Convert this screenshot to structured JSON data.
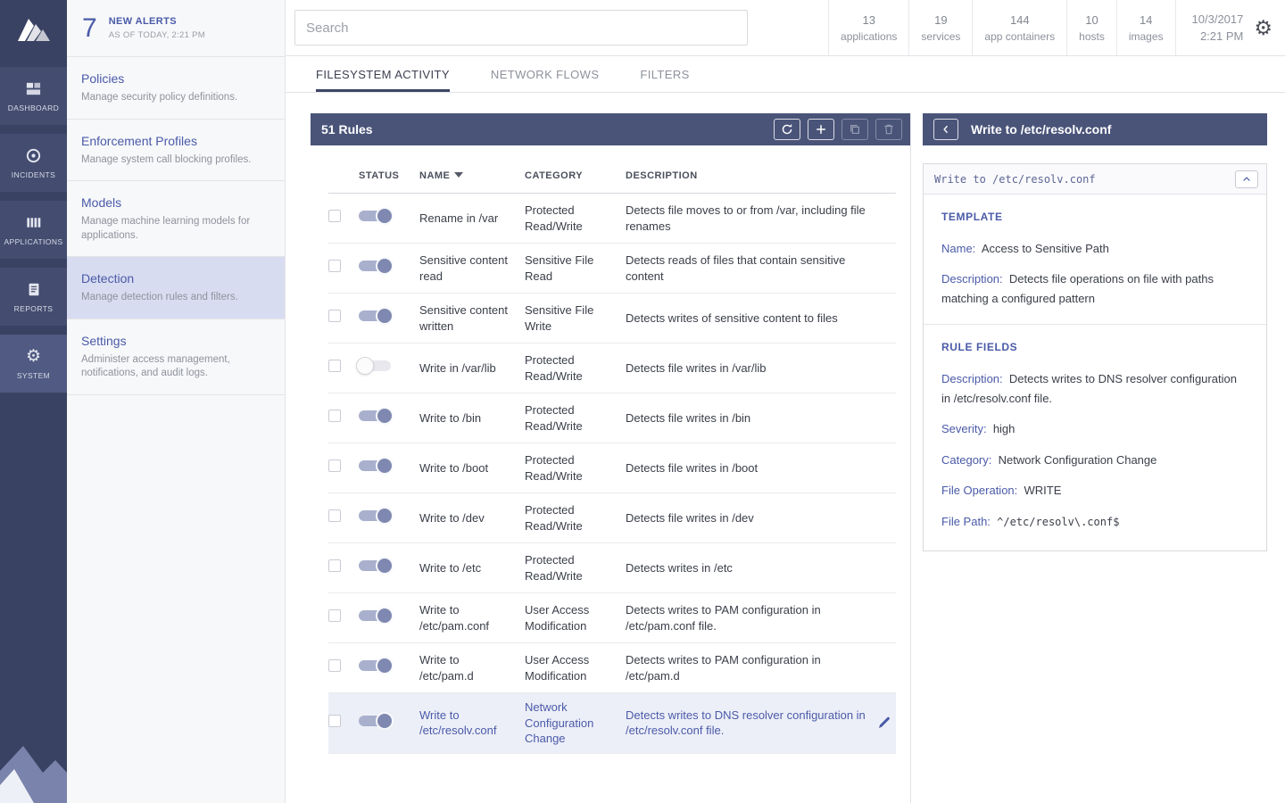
{
  "colors": {
    "accent_blue": "#4a5aa8",
    "panel_header_bg": "#4a5479",
    "sidebar_bg": "#3a4263",
    "selected_row_bg": "#edeff8"
  },
  "alerts": {
    "count": "7",
    "title": "NEW ALERTS",
    "subtitle": "AS OF TODAY, 2:21 PM"
  },
  "nav": {
    "items": [
      {
        "label": "DASHBOARD",
        "icon": "dashboard",
        "active": false
      },
      {
        "label": "INCIDENTS",
        "icon": "incidents",
        "active": false
      },
      {
        "label": "APPLICATIONS",
        "icon": "applications",
        "active": false
      },
      {
        "label": "REPORTS",
        "icon": "reports",
        "active": false
      },
      {
        "label": "SYSTEM",
        "icon": "system",
        "active": true
      }
    ]
  },
  "menu": {
    "items": [
      {
        "title": "Policies",
        "description": "Manage security policy definitions.",
        "active": false
      },
      {
        "title": "Enforcement Profiles",
        "description": "Manage system call blocking profiles.",
        "active": false
      },
      {
        "title": "Models",
        "description": "Manage machine learning models for applications.",
        "active": false
      },
      {
        "title": "Detection",
        "description": "Manage detection rules and filters.",
        "active": true
      },
      {
        "title": "Settings",
        "description": "Administer access management, notifications, and audit logs.",
        "active": false
      }
    ]
  },
  "topbar": {
    "search_placeholder": "Search",
    "stats": [
      {
        "value": "13",
        "label": "applications"
      },
      {
        "value": "19",
        "label": "services"
      },
      {
        "value": "144",
        "label": "app containers"
      },
      {
        "value": "10",
        "label": "hosts"
      },
      {
        "value": "14",
        "label": "images"
      }
    ],
    "datetime": {
      "date": "10/3/2017",
      "time": "2:21 PM"
    }
  },
  "tabs": [
    {
      "label": "FILESYSTEM ACTIVITY",
      "active": true
    },
    {
      "label": "NETWORK FLOWS",
      "active": false
    },
    {
      "label": "FILTERS",
      "active": false
    }
  ],
  "rules_panel": {
    "title": "51 Rules",
    "actions": [
      {
        "icon": "refresh",
        "disabled": false
      },
      {
        "icon": "add",
        "disabled": false
      },
      {
        "icon": "copy",
        "disabled": true
      },
      {
        "icon": "delete",
        "disabled": true
      }
    ],
    "columns": {
      "status": "STATUS",
      "name": "NAME",
      "category": "CATEGORY",
      "description": "DESCRIPTION"
    },
    "rows": [
      {
        "name": "Rename in /var",
        "category": "Protected Read/Write",
        "description": "Detects file moves to or from /var, including file renames",
        "enabled": true,
        "selected": false
      },
      {
        "name": "Sensitive content read",
        "category": "Sensitive File Read",
        "description": "Detects reads of files that contain sensitive content",
        "enabled": true,
        "selected": false
      },
      {
        "name": "Sensitive content written",
        "category": "Sensitive File Write",
        "description": "Detects writes of sensitive content to files",
        "enabled": true,
        "selected": false
      },
      {
        "name": "Write in /var/lib",
        "category": "Protected Read/Write",
        "description": "Detects file writes in /var/lib",
        "enabled": false,
        "selected": false
      },
      {
        "name": "Write to /bin",
        "category": "Protected Read/Write",
        "description": "Detects file writes in /bin",
        "enabled": true,
        "selected": false
      },
      {
        "name": "Write to /boot",
        "category": "Protected Read/Write",
        "description": "Detects file writes in /boot",
        "enabled": true,
        "selected": false
      },
      {
        "name": "Write to /dev",
        "category": "Protected Read/Write",
        "description": "Detects file writes in /dev",
        "enabled": true,
        "selected": false
      },
      {
        "name": "Write to /etc",
        "category": "Protected Read/Write",
        "description": "Detects writes in /etc",
        "enabled": true,
        "selected": false
      },
      {
        "name": "Write to /etc/pam.conf",
        "category": "User Access Modification",
        "description": "Detects writes to PAM configuration in /etc/pam.conf file.",
        "enabled": true,
        "selected": false
      },
      {
        "name": "Write to /etc/pam.d",
        "category": "User Access Modification",
        "description": "Detects writes to PAM configuration in /etc/pam.d",
        "enabled": true,
        "selected": false
      },
      {
        "name": "Write to /etc/resolv.conf",
        "category": "Network Configuration Change",
        "description": "Detects writes to DNS resolver configuration in /etc/resolv.conf file.",
        "enabled": true,
        "selected": true
      }
    ]
  },
  "detail_panel": {
    "title": "Write to /etc/resolv.conf",
    "card_title": "Write to /etc/resolv.conf",
    "template": {
      "heading": "TEMPLATE",
      "fields": [
        {
          "label": "Name:",
          "value": "Access to Sensitive Path",
          "mono": false
        },
        {
          "label": "Description:",
          "value": "Detects file operations on file with paths matching a configured pattern",
          "mono": false
        }
      ]
    },
    "rule_fields": {
      "heading": "RULE FIELDS",
      "fields": [
        {
          "label": "Description:",
          "value": "Detects writes to DNS resolver configuration in /etc/resolv.conf file.",
          "mono": false
        },
        {
          "label": "Severity:",
          "value": "high",
          "mono": false
        },
        {
          "label": "Category:",
          "value": "Network Configuration Change",
          "mono": false
        },
        {
          "label": "File Operation:",
          "value": "WRITE",
          "mono": false
        },
        {
          "label": "File Path:",
          "value": "^/etc/resolv\\.conf$",
          "mono": true
        }
      ]
    }
  }
}
